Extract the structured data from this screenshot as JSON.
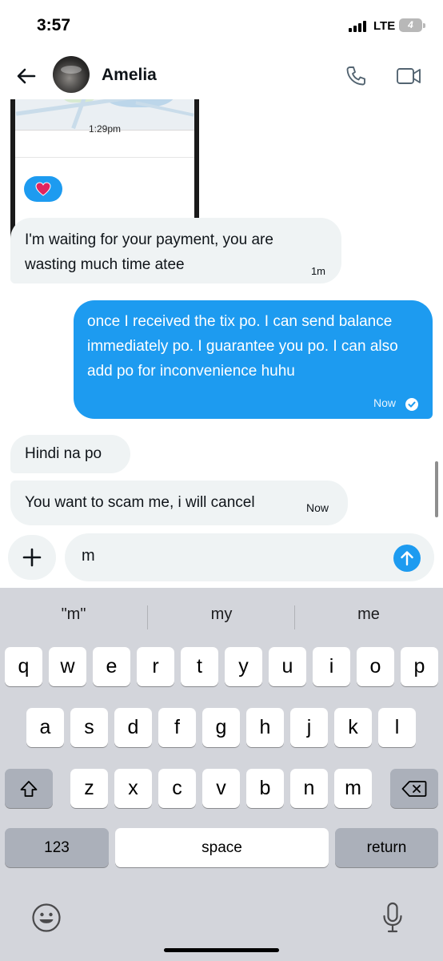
{
  "status_bar": {
    "time": "3:57",
    "network": "LTE",
    "battery": "4"
  },
  "header": {
    "contact_name": "Amelia"
  },
  "chat": {
    "image_message": {
      "time": "1:29pm"
    },
    "messages": [
      {
        "text": "I'm waiting for your payment, you are wasting much time atee",
        "time": "1m"
      },
      {
        "text": "once I received the tix po. I can send balance immediately po. I guarantee you po. I can also add po for inconvenience huhu",
        "time": "Now"
      },
      {
        "text": "Hindi na po"
      },
      {
        "text": "You want to scam me, i will cancel",
        "time": "Now"
      }
    ]
  },
  "composer": {
    "value": "m"
  },
  "keyboard": {
    "suggestions": [
      "\"m\"",
      "my",
      "me"
    ],
    "row1": [
      "q",
      "w",
      "e",
      "r",
      "t",
      "y",
      "u",
      "i",
      "o",
      "p"
    ],
    "row2": [
      "a",
      "s",
      "d",
      "f",
      "g",
      "h",
      "j",
      "k",
      "l"
    ],
    "row3": [
      "z",
      "x",
      "c",
      "v",
      "b",
      "n",
      "m"
    ],
    "numbers_label": "123",
    "space_label": "space",
    "return_label": "return"
  },
  "colors": {
    "accent": "#1d9bf0",
    "incoming_bubble": "#eff3f4",
    "keyboard_bg": "#d3d5db",
    "heart": "#e0245e"
  }
}
